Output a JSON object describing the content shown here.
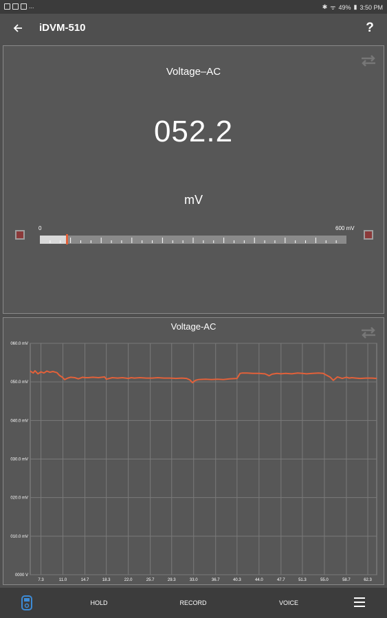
{
  "status_bar": {
    "battery": "49%",
    "time": "3:50 PM",
    "more": "..."
  },
  "app_bar": {
    "title": "iDVM-510",
    "help_label": "?"
  },
  "meter": {
    "mode": "Voltage–AC",
    "reading": "052.2",
    "unit": "mV",
    "range_min_label": "0",
    "range_max_label": "600 mV",
    "level_fraction": 0.087
  },
  "chart": {
    "title": "Voltage-AC",
    "chart_data": {
      "type": "line",
      "title": "Voltage-AC",
      "y_tick_labels": [
        "060.0 mV",
        "050.0 mV",
        "040.0 mV",
        "030.0 mV",
        "020.0 mV",
        "010.0 mV",
        "0000 V"
      ],
      "y_ticks": [
        60,
        50,
        40,
        30,
        20,
        10,
        0
      ],
      "ylim": [
        0,
        60
      ],
      "x_tick_labels": [
        "7.3",
        "11.0",
        "14.7",
        "18.3",
        "22.0",
        "25.7",
        "29.3",
        "33.0",
        "36.7",
        "40.3",
        "44.0",
        "47.7",
        "51.3",
        "55.0",
        "58.7",
        "62.3"
      ],
      "x_ticks": [
        7.3,
        11.0,
        14.7,
        18.3,
        22.0,
        25.7,
        29.3,
        33.0,
        36.7,
        40.3,
        44.0,
        47.7,
        51.3,
        55.0,
        58.7,
        62.3
      ],
      "xlim": [
        5.5,
        63.8
      ],
      "grid": true,
      "line_color": "#e2613a",
      "series": [
        {
          "x": [
            5.5,
            6.0,
            6.3,
            6.8,
            7.3,
            7.8,
            8.3,
            8.8,
            9.3,
            10.0,
            10.4,
            10.9,
            11.3,
            11.8,
            12.3,
            13.0,
            13.6,
            14.3,
            14.7,
            15.3,
            16.0,
            17.0,
            18.0,
            18.3,
            18.8,
            19.3,
            20.2,
            21.0,
            22.0,
            22.5,
            23.0,
            24.0,
            25.0,
            26.0,
            27.0,
            28.0,
            29.0,
            30.0,
            31.0,
            31.8,
            32.4,
            32.8,
            33.3,
            33.8,
            35.0,
            36.0,
            37.0,
            38.0,
            39.0,
            40.3,
            40.8,
            41.2,
            42.0,
            43.0,
            44.0,
            45.0,
            45.7,
            46.2,
            47.0,
            47.7,
            48.5,
            49.5,
            50.5,
            51.3,
            52.0,
            53.0,
            54.0,
            54.8,
            55.3,
            56.0,
            56.5,
            57.2,
            58.0,
            58.7,
            59.2,
            59.6,
            60.3,
            61.0,
            62.0,
            63.0,
            63.8
          ],
          "y": [
            52.8,
            52.3,
            52.9,
            52.1,
            52.6,
            52.3,
            52.8,
            52.5,
            52.7,
            52.4,
            51.7,
            51.2,
            50.6,
            51.0,
            51.2,
            51.1,
            50.8,
            51.2,
            51.1,
            51.1,
            51.2,
            51.1,
            51.3,
            50.7,
            50.9,
            51.1,
            51.0,
            51.1,
            50.9,
            51.1,
            51.0,
            51.1,
            51.0,
            51.0,
            51.1,
            51.0,
            51.0,
            50.9,
            51.0,
            50.9,
            50.5,
            49.8,
            50.4,
            50.6,
            50.7,
            50.6,
            50.7,
            50.6,
            50.8,
            50.9,
            52.2,
            52.3,
            52.3,
            52.2,
            52.2,
            52.1,
            51.6,
            52.0,
            52.2,
            52.1,
            52.2,
            52.1,
            52.3,
            52.2,
            52.1,
            52.2,
            52.3,
            52.2,
            51.8,
            51.2,
            50.4,
            51.3,
            50.9,
            51.2,
            51.0,
            51.1,
            51.0,
            50.9,
            51.0,
            51.0,
            50.9
          ]
        }
      ]
    }
  },
  "bottom_nav": {
    "hold_label": "HOLD",
    "record_label": "RECORD",
    "voice_label": "VOICE"
  },
  "colors": {
    "background": "#4f4f4f",
    "panel": "#575757",
    "accent": "#e2613a",
    "indicator": "#8b3a3a",
    "device_icon": "#3d8bd6"
  },
  "icons": {
    "back": "arrow-left-icon",
    "help": "question-icon",
    "swap": "swap-arrows-icon",
    "device": "meter-device-icon",
    "menu": "hamburger-menu-icon"
  }
}
